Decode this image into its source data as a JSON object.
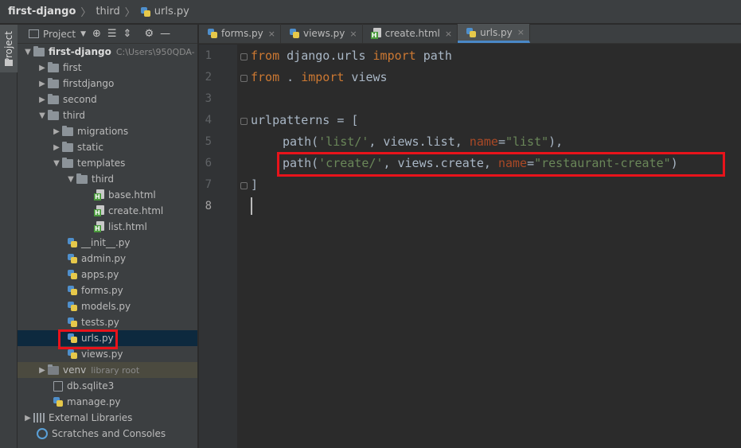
{
  "breadcrumb": {
    "project": "first-django",
    "folder": "third",
    "file": "urls.py"
  },
  "side_strip": {
    "project_label": "Project"
  },
  "project_panel": {
    "title": "Project",
    "root_name": "first-django",
    "root_path": "C:\\Users\\950QDA-"
  },
  "tree": {
    "first": "first",
    "firstdjango": "firstdjango",
    "second": "second",
    "third": "third",
    "migrations": "migrations",
    "static": "static",
    "templates": "templates",
    "templates_third": "third",
    "base_html": "base.html",
    "create_html": "create.html",
    "list_html": "list.html",
    "init_py": "__init__.py",
    "admin_py": "admin.py",
    "apps_py": "apps.py",
    "forms_py": "forms.py",
    "models_py": "models.py",
    "tests_py": "tests.py",
    "urls_py": "urls.py",
    "views_py": "views.py",
    "venv": "venv",
    "venv_hint": "library root",
    "db": "db.sqlite3",
    "manage_py": "manage.py",
    "external_libraries": "External Libraries",
    "scratches": "Scratches and Consoles"
  },
  "tabs": [
    {
      "label": "forms.py",
      "type": "py"
    },
    {
      "label": "views.py",
      "type": "py"
    },
    {
      "label": "create.html",
      "type": "html"
    },
    {
      "label": "urls.py",
      "type": "py",
      "active": true
    }
  ],
  "tab_close_glyph": "×",
  "line_numbers": [
    "1",
    "2",
    "3",
    "4",
    "5",
    "6",
    "7",
    "8"
  ],
  "code": {
    "l1": {
      "kw1": "from",
      "mod": " django.urls ",
      "kw2": "import",
      "name": " path"
    },
    "l2": {
      "kw1": "from",
      "mod": " . ",
      "kw2": "import",
      "name": " views"
    },
    "l4": {
      "text": "urlpatterns = ["
    },
    "l5": {
      "fn": "path(",
      "str1": "'list/'",
      "mid": ", views.list, ",
      "param": "name",
      "eq": "=",
      "str2": "\"list\"",
      "end": "),"
    },
    "l6": {
      "fn": "path(",
      "str1": "'create/'",
      "mid": ", views.create, ",
      "param": "name",
      "eq": "=",
      "str2": "\"restaurant-create\"",
      "end": ")"
    },
    "l7": {
      "text": "]"
    }
  },
  "colors": {
    "keyword": "#cc7832",
    "string": "#6a8759",
    "param": "#aa4926",
    "highlight_box": "#e8131b",
    "selection": "#0d293e"
  }
}
